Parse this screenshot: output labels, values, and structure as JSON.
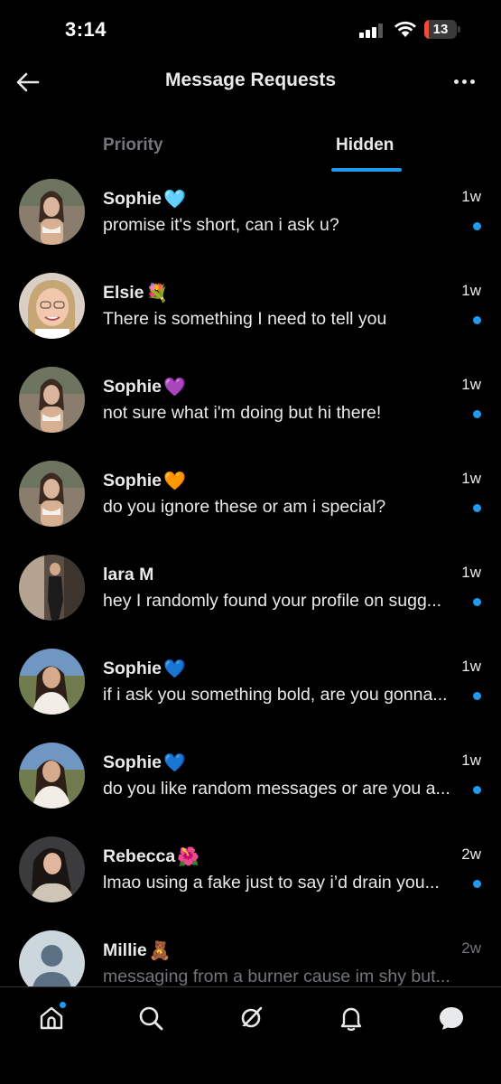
{
  "status_bar": {
    "time": "3:14",
    "battery_percent": 13
  },
  "header": {
    "title": "Message Requests",
    "back_icon": "arrow-left-icon",
    "more_icon": "more-horizontal-icon"
  },
  "tabs": [
    {
      "label": "Priority",
      "active": false
    },
    {
      "label": "Hidden",
      "active": true
    }
  ],
  "accent_color": "#1d9bf0",
  "conversations": [
    {
      "name": "Sophie",
      "emoji": "🩵",
      "time": "1w",
      "preview": "promise it's short, can i ask u?",
      "unread": true,
      "avatar": "photo"
    },
    {
      "name": "Elsie",
      "emoji": "💐",
      "time": "1w",
      "preview": "There is something I need to tell you",
      "unread": true,
      "avatar": "photo"
    },
    {
      "name": "Sophie",
      "emoji": "💜",
      "time": "1w",
      "preview": "not sure what i'm doing but hi there!",
      "unread": true,
      "avatar": "photo"
    },
    {
      "name": "Sophie",
      "emoji": "🧡",
      "time": "1w",
      "preview": "do you ignore these or am i special?",
      "unread": true,
      "avatar": "photo"
    },
    {
      "name": "lara M",
      "emoji": "",
      "time": "1w",
      "preview": "hey I randomly found your profile on sugg...",
      "unread": true,
      "avatar": "photo"
    },
    {
      "name": "Sophie",
      "emoji": "💙",
      "time": "1w",
      "preview": "if i ask you something bold, are you gonna...",
      "unread": true,
      "avatar": "photo"
    },
    {
      "name": "Sophie",
      "emoji": "💙",
      "time": "1w",
      "preview": "do you like random messages or are you a...",
      "unread": true,
      "avatar": "photo"
    },
    {
      "name": "Rebecca",
      "emoji": "🌺",
      "time": "2w",
      "preview": "lmao using a fake just to say i’d drain you...",
      "unread": true,
      "avatar": "photo"
    },
    {
      "name": "Millie",
      "emoji": "🧸",
      "time": "2w",
      "preview": "messaging from a burner cause im shy but...",
      "unread": false,
      "avatar": "default-avatar"
    }
  ],
  "bottom_nav": [
    {
      "icon": "home-icon",
      "badge": true
    },
    {
      "icon": "search-icon",
      "badge": false
    },
    {
      "icon": "grok-icon",
      "badge": false
    },
    {
      "icon": "bell-icon",
      "badge": false
    },
    {
      "icon": "messages-icon",
      "badge": false
    }
  ]
}
